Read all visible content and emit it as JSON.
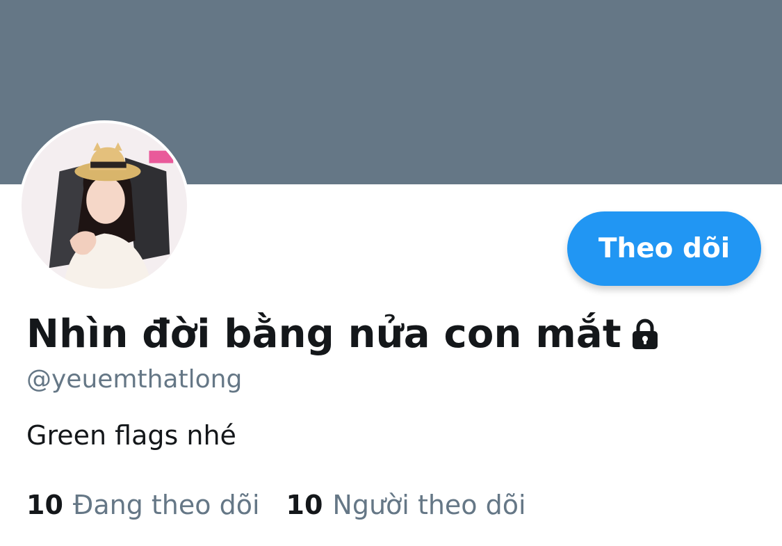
{
  "profile": {
    "banner_color": "#657786",
    "display_name": "Nhìn đời bằng nửa con mắt",
    "protected_icon": "lock-icon",
    "handle": "@yeuemthatlong",
    "bio": "Green flags nhé",
    "follow_label": "Theo dõi",
    "accent_color": "#2196f3"
  },
  "stats": {
    "following_count": "10",
    "following_label": "Đang theo dõi",
    "followers_count": "10",
    "followers_label": "Người theo dõi"
  }
}
